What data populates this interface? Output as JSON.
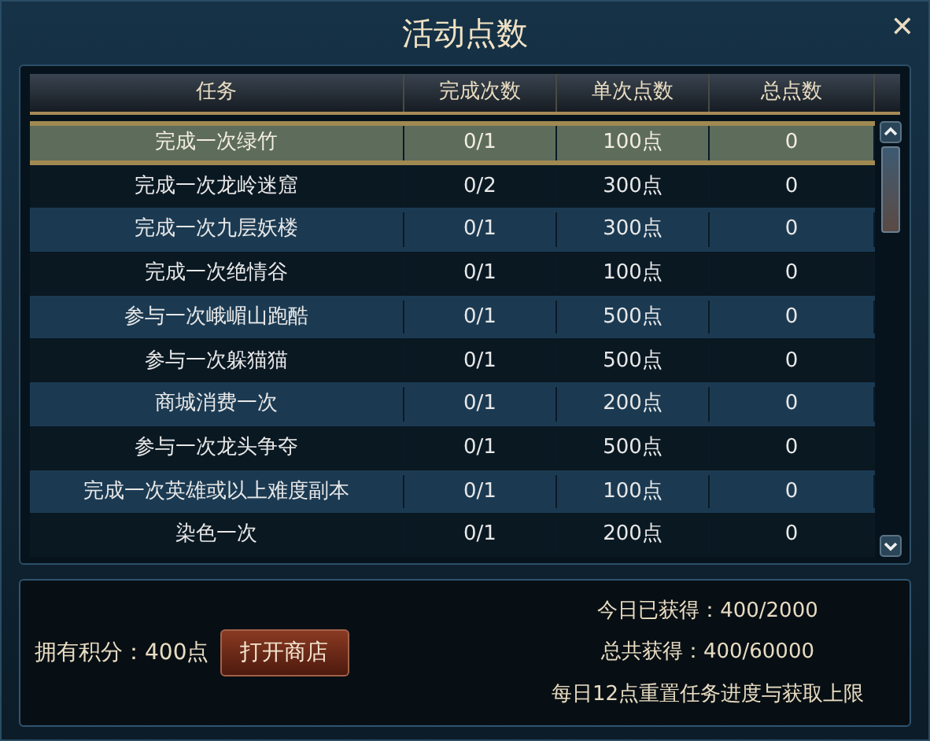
{
  "window": {
    "title": "活动点数",
    "close": "✕"
  },
  "table": {
    "columns": [
      "任务",
      "完成次数",
      "单次点数",
      "总点数"
    ],
    "rows": [
      {
        "cells": [
          "完成一次绿竹",
          "0/1",
          "100点",
          "0"
        ],
        "selected": true
      },
      {
        "cells": [
          "完成一次龙岭迷窟",
          "0/2",
          "300点",
          "0"
        ],
        "selected": false
      },
      {
        "cells": [
          "完成一次九层妖楼",
          "0/1",
          "300点",
          "0"
        ],
        "selected": false
      },
      {
        "cells": [
          "完成一次绝情谷",
          "0/1",
          "100点",
          "0"
        ],
        "selected": false
      },
      {
        "cells": [
          "参与一次峨嵋山跑酷",
          "0/1",
          "500点",
          "0"
        ],
        "selected": false
      },
      {
        "cells": [
          "参与一次躲猫猫",
          "0/1",
          "500点",
          "0"
        ],
        "selected": false
      },
      {
        "cells": [
          "商城消费一次",
          "0/1",
          "200点",
          "0"
        ],
        "selected": false
      },
      {
        "cells": [
          "参与一次龙头争夺",
          "0/1",
          "500点",
          "0"
        ],
        "selected": false
      },
      {
        "cells": [
          "完成一次英雄或以上难度副本",
          "0/1",
          "100点",
          "0"
        ],
        "selected": false
      },
      {
        "cells": [
          "染色一次",
          "0/1",
          "200点",
          "0"
        ],
        "selected": false
      }
    ]
  },
  "footer": {
    "points": "拥有积分：400点",
    "shop_button": "打开商店",
    "today": "今日已获得：400/2000",
    "total": "总共获得：400/60000",
    "note": "每日12点重置任务进度与获取上限"
  }
}
